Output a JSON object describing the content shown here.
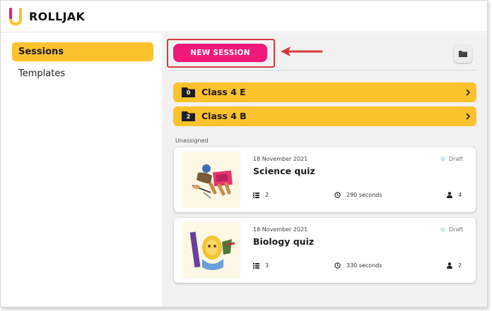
{
  "app": {
    "name": "ROLLJAK"
  },
  "sidebar": {
    "items": [
      {
        "label": "Sessions",
        "active": true
      },
      {
        "label": "Templates",
        "active": false
      }
    ]
  },
  "toolbar": {
    "new_session_label": "NEW SESSION",
    "folder_icon": "folder-icon"
  },
  "classes": [
    {
      "count": "0",
      "name": "Class 4 E"
    },
    {
      "count": "2",
      "name": "Class 4 B"
    }
  ],
  "unassigned_label": "Unassigned",
  "quizzes": [
    {
      "date": "18 November 2021",
      "title": "Science quiz",
      "status": "Draft",
      "questions": "2",
      "duration": "290 seconds",
      "participants": "4"
    },
    {
      "date": "18 November 2021",
      "title": "Biology quiz",
      "status": "Draft",
      "questions": "3",
      "duration": "330 seconds",
      "participants": "2"
    }
  ],
  "colors": {
    "accent_yellow": "#fcc22e",
    "primary_pink": "#f0197a",
    "highlight_red": "#d63a3a"
  }
}
